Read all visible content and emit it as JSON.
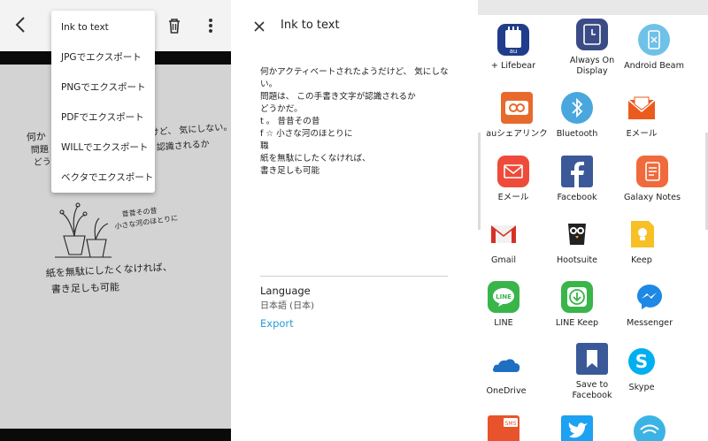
{
  "handwriting_screen": {
    "export_menu": {
      "items": [
        "Ink to text",
        "JPGでエクスポート",
        "PNGでエクスポート",
        "PDFでエクスポート",
        "WILLでエクスポート",
        "ベクタでエクスポート"
      ]
    },
    "handwriting": {
      "line1": "何か",
      "line1b": "けど、 気にしない。",
      "line2": "問題",
      "line2b": "認識されるか",
      "line3": "どうか",
      "sketch_line1": "昔昔その昔",
      "sketch_line2": "小さな河のほとりに",
      "line4": "紙を無駄にしたくなければ、",
      "line5": "書き足しも可能"
    },
    "colors": {
      "canvas": "#d3d3d3",
      "bar": "#0a0a0a"
    }
  },
  "ink_to_text_screen": {
    "title": "Ink to text",
    "recognized_lines": [
      "何かアクティベートされたようだけど、 気にしな",
      "い。",
      "問題は、 この手書き文字が認識されるか",
      "どうかだ。",
      "t 。 昔昔その昔",
      "f ☆ 小さな河のほとりに",
      "職",
      "紙を無駄にしたくなければ、",
      "書き足しも可能"
    ],
    "language_label": "Language",
    "language_value": "日本語 (日本)",
    "export_label": "Export",
    "colors": {
      "export": "#2a9bd6"
    }
  },
  "share_sheet": {
    "apps": [
      {
        "label": "+ Lifebear",
        "icon": "lifebear-icon"
      },
      {
        "label": "Always On Display",
        "icon": "always-on-display-icon"
      },
      {
        "label": "Android Beam",
        "icon": "android-beam-icon"
      },
      {
        "label": "auシェアリンク",
        "icon": "au-share-link-icon"
      },
      {
        "label": "Bluetooth",
        "icon": "bluetooth-icon"
      },
      {
        "label": "Eメール",
        "icon": "au-email-icon"
      },
      {
        "label": "Eメール",
        "icon": "samsung-email-icon"
      },
      {
        "label": "Facebook",
        "icon": "facebook-icon"
      },
      {
        "label": "Galaxy Notes",
        "icon": "galaxy-notes-icon"
      },
      {
        "label": "Gmail",
        "icon": "gmail-icon"
      },
      {
        "label": "Hootsuite",
        "icon": "hootsuite-icon"
      },
      {
        "label": "Keep",
        "icon": "keep-icon"
      },
      {
        "label": "LINE",
        "icon": "line-icon"
      },
      {
        "label": "LINE Keep",
        "icon": "line-keep-icon"
      },
      {
        "label": "Messenger",
        "icon": "messenger-icon"
      },
      {
        "label": "OneDrive",
        "icon": "onedrive-icon"
      },
      {
        "label": "Save to Facebook",
        "icon": "save-to-facebook-icon"
      },
      {
        "label": "Skype",
        "icon": "skype-icon"
      },
      {
        "label": "",
        "icon": "sms-icon"
      },
      {
        "label": "",
        "icon": "twitter-icon"
      },
      {
        "label": "",
        "icon": "wifi-direct-icon"
      }
    ],
    "badges": {
      "lifebear": "au",
      "sms": "SMS"
    }
  }
}
